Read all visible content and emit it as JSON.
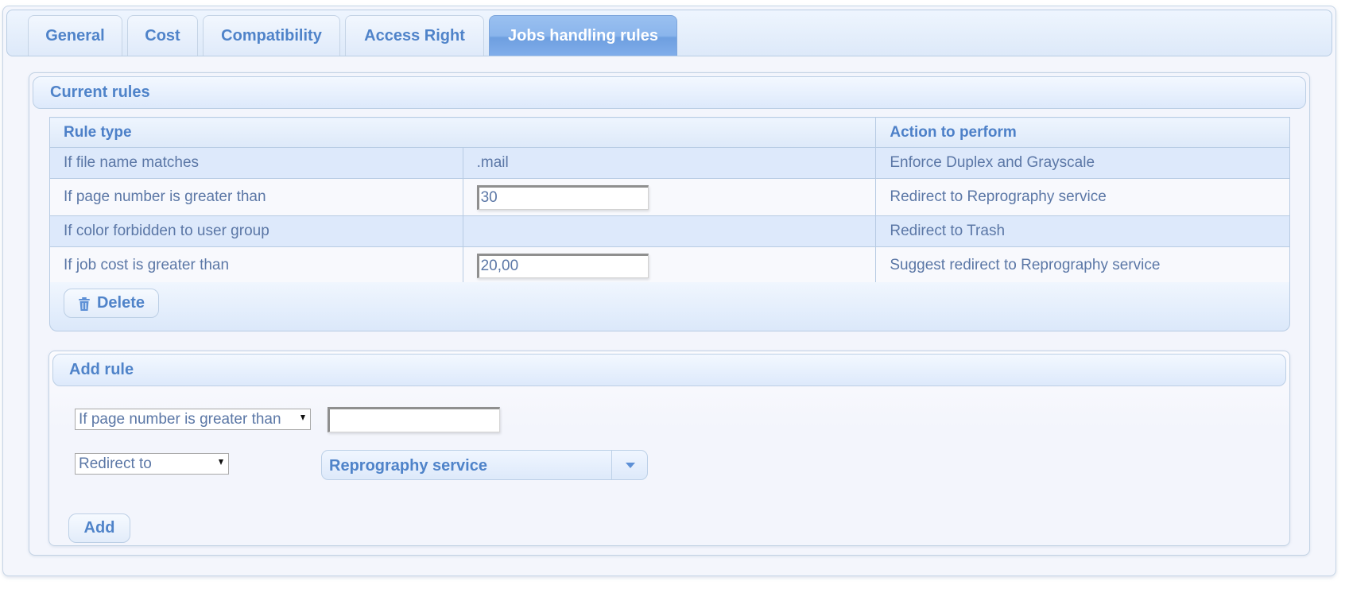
{
  "tabs": [
    {
      "label": "General",
      "active": false
    },
    {
      "label": "Cost",
      "active": false
    },
    {
      "label": "Compatibility",
      "active": false
    },
    {
      "label": "Access Right",
      "active": false
    },
    {
      "label": "Jobs handling rules",
      "active": true
    }
  ],
  "current_rules": {
    "title": "Current rules",
    "columns": {
      "rule_type": "Rule type",
      "action": "Action to perform"
    },
    "rows": [
      {
        "rule": "If file name matches",
        "value": ".mail",
        "value_is_input": false,
        "action": "Enforce Duplex and Grayscale"
      },
      {
        "rule": "If page number is greater than",
        "value": "30",
        "value_is_input": true,
        "action": "Redirect to Reprography service"
      },
      {
        "rule": "If color forbidden to user group",
        "value": "",
        "value_is_input": false,
        "action": "Redirect to Trash"
      },
      {
        "rule": "If job cost is greater than",
        "value": "20,00",
        "value_is_input": true,
        "action": "Suggest redirect to Reprography service"
      }
    ],
    "delete_label": "Delete",
    "delete_icon": "trash-icon"
  },
  "add_rule": {
    "title": "Add rule",
    "rule_type_selected": "If page number is greater than",
    "rule_value": "",
    "action_selected": "Redirect to",
    "target_selected": "Reprography service",
    "add_label": "Add"
  },
  "colors": {
    "accent": "#4f83c9",
    "active_tab": "#80adea",
    "text": "#5b77a6",
    "row_alt": "#dde9fb"
  }
}
